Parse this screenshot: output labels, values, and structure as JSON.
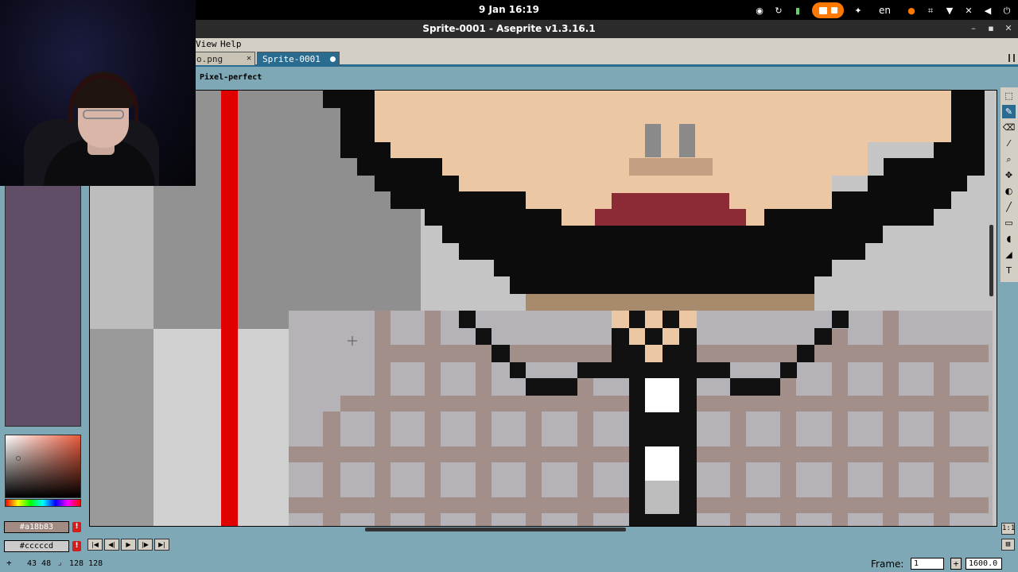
{
  "topbar": {
    "clock": "9 Jan  16:19",
    "language": "en",
    "icons": [
      "steam-icon",
      "update-icon",
      "lock-icon",
      "screencast-icon",
      "accessibility-icon",
      "microphone-icon",
      "network-icon",
      "wifi-icon",
      "notifications-off-icon",
      "volume-icon",
      "power-icon"
    ]
  },
  "window": {
    "title": "Sprite-0001 - Aseprite v1.3.16.1"
  },
  "menu": {
    "items": [
      "View",
      "Help"
    ]
  },
  "tabs": [
    {
      "label": "o.png"
    },
    {
      "label": "Sprite-0001"
    }
  ],
  "context": {
    "pixel_perfect_label": "Pixel-perfect"
  },
  "colors": {
    "foreground_hex": "#a18b83",
    "background_hex": "#cccccd",
    "palette_swatch": "#5f4e66",
    "ui_accent": "#2a6b90"
  },
  "tools": [
    "marquee-icon",
    "pencil-icon",
    "eraser-icon",
    "eyedropper-icon",
    "zoom-icon",
    "move-icon",
    "fill-icon",
    "line-icon",
    "rectangle-icon",
    "blur-icon",
    "smudge-icon",
    "text-icon"
  ],
  "side_buttons": {
    "one_to_one": "1:1"
  },
  "status": {
    "cursor_pos": "43 48",
    "sprite_size": "128 128",
    "frame_label": "Frame:",
    "frame_value": "1",
    "zoom_value": "1600.0"
  }
}
